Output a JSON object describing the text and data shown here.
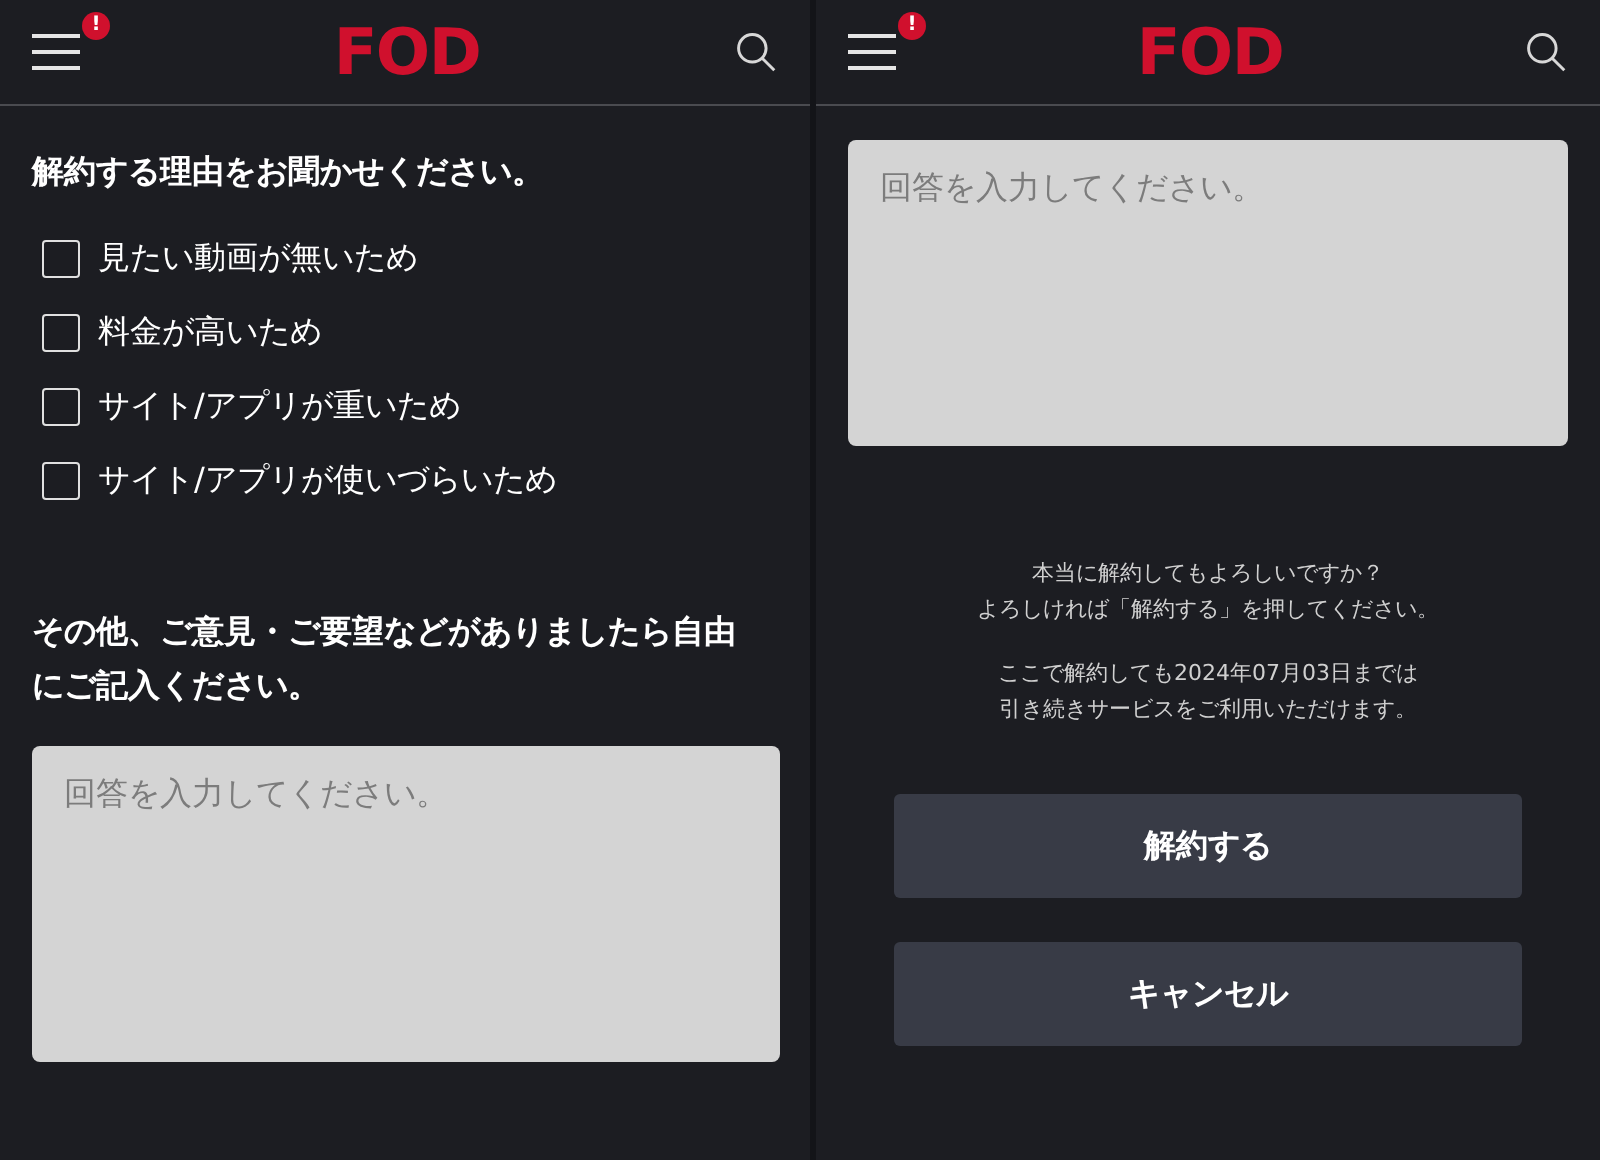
{
  "left_screen": {
    "header": {
      "badge": "!",
      "logo": "FOD"
    },
    "reasons_title": "解約する理由をお聞かせください。",
    "reasons": [
      {
        "label": "見たい動画が無いため",
        "checked": false
      },
      {
        "label": "料金が高いため",
        "checked": false
      },
      {
        "label": "サイト/アプリが重いため",
        "checked": false
      },
      {
        "label": "サイト/アプリが使いづらいため",
        "checked": false
      }
    ],
    "comment_title": "その他、ご意見・ご要望などがありましたら自由にご記入ください。",
    "comment_field": {
      "placeholder": "回答を入力してください。"
    }
  },
  "right_screen": {
    "header": {
      "badge": "!",
      "logo": "FOD"
    },
    "comment_field": {
      "placeholder": "回答を入力してください。"
    },
    "confirm_lines": [
      "本当に解約してもよろしいですか？",
      "よろしければ「解約する」を押してください。"
    ],
    "notice_lines": [
      "ここで解約しても2024年07月03日までは",
      "引き続きサービスをご利用いただけます。"
    ],
    "buttons": [
      "解約する",
      "キャンセル"
    ]
  }
}
